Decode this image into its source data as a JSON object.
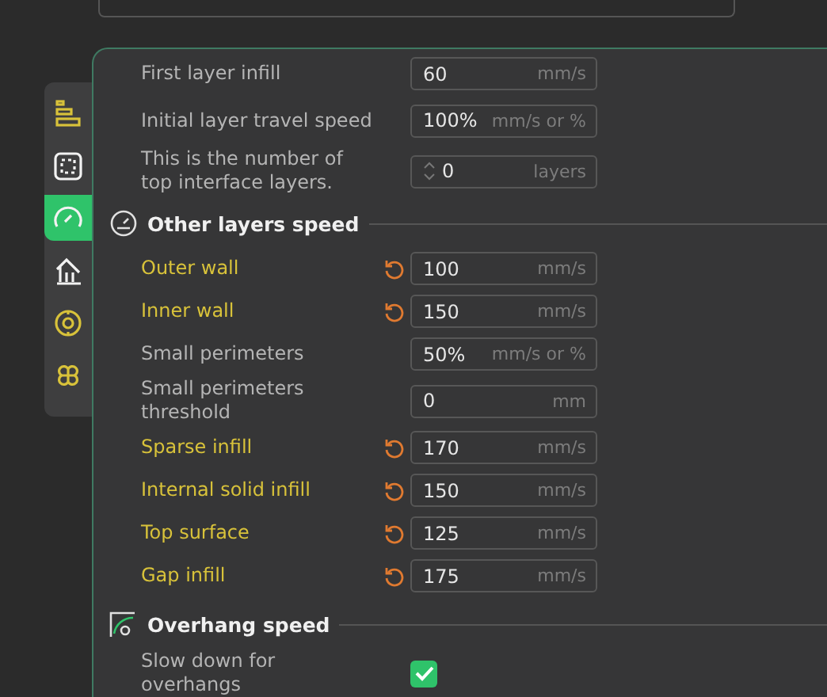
{
  "sidebar": {
    "items": [
      {
        "kind": "layers",
        "selected": false,
        "modified": true
      },
      {
        "kind": "frame",
        "selected": false,
        "modified": false
      },
      {
        "kind": "speedometer",
        "selected": true,
        "modified": false
      },
      {
        "kind": "support",
        "selected": false,
        "modified": false
      },
      {
        "kind": "target",
        "selected": false,
        "modified": true
      },
      {
        "kind": "clover",
        "selected": false,
        "modified": true
      }
    ]
  },
  "groups": [
    {
      "rows": [
        {
          "kind": "field",
          "label": "First layer infill",
          "value": "60",
          "unit": "mm/s",
          "modified": false
        },
        {
          "kind": "field",
          "label": "Initial layer travel speed",
          "value": "100%",
          "unit": "mm/s or %",
          "modified": false
        },
        {
          "kind": "spin",
          "label": "This is the number of top interface layers.",
          "value": "0",
          "unit": "layers",
          "modified": false
        }
      ]
    },
    {
      "title": "Other layers speed",
      "kind": "gauge",
      "rows": [
        {
          "kind": "field",
          "label": "Outer wall",
          "value": "100",
          "unit": "mm/s",
          "modified": true
        },
        {
          "kind": "field",
          "label": "Inner wall",
          "value": "150",
          "unit": "mm/s",
          "modified": true
        },
        {
          "kind": "field",
          "label": "Small perimeters",
          "value": "50%",
          "unit": "mm/s or %",
          "modified": false
        },
        {
          "kind": "field",
          "label": "Small perimeters threshold",
          "value": "0",
          "unit": "mm",
          "modified": false
        },
        {
          "kind": "field",
          "label": "Sparse infill",
          "value": "170",
          "unit": "mm/s",
          "modified": true
        },
        {
          "kind": "field",
          "label": "Internal solid infill",
          "value": "150",
          "unit": "mm/s",
          "modified": true
        },
        {
          "kind": "field",
          "label": "Top surface",
          "value": "125",
          "unit": "mm/s",
          "modified": true
        },
        {
          "kind": "field",
          "label": "Gap infill",
          "value": "175",
          "unit": "mm/s",
          "modified": true
        }
      ]
    },
    {
      "title": "Overhang speed",
      "kind": "overhang",
      "rows": [
        {
          "kind": "checkbox",
          "label": "Slow down for overhangs",
          "checked": true,
          "modified": false
        }
      ]
    }
  ]
}
